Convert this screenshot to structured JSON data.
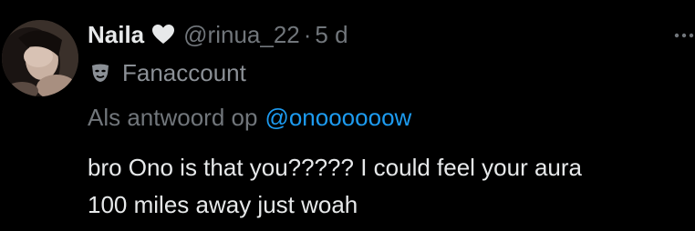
{
  "post": {
    "author": {
      "display_name": "Naila",
      "badge_icon": "heart-icon",
      "handle": "@rinua_22",
      "separator": "·",
      "time": "5 d",
      "avatar": "avatar-photo"
    },
    "label": {
      "icon": "mask-icon",
      "text": "Fanaccount"
    },
    "reply_context": {
      "prefix": "Als antwoord op",
      "mention": "@onoooooow"
    },
    "text_lines": [
      "bro Ono is that you????? I could feel your aura",
      "100 miles away just woah"
    ],
    "more_icon": "more-options-icon"
  },
  "colors": {
    "background": "#000000",
    "primary_text": "#e7e9ea",
    "secondary_text": "#71767b",
    "link": "#1d9bf0"
  }
}
